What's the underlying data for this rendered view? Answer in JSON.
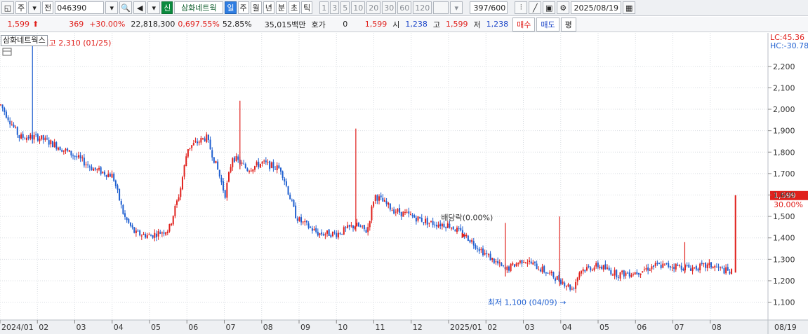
{
  "toolbar": {
    "market": "주",
    "prev_label": "전",
    "code": "046390",
    "badge_new": "신",
    "stock_name": "삼화네트웍",
    "periods": [
      "일",
      "주",
      "월",
      "년",
      "분",
      "초",
      "틱"
    ],
    "minutes": [
      "1",
      "3",
      "5",
      "10",
      "20",
      "30",
      "60",
      "120"
    ],
    "count": "397/600",
    "date": "2025/08/19"
  },
  "info": {
    "price": "1,599",
    "arrow": "⬆",
    "change": "369",
    "change_pct": "+30.00%",
    "volume": "22,818,300",
    "vol_pct": "0,697.55%",
    "turnover": "52.85%",
    "amount": "35,015백만",
    "quote_label": "호가",
    "quote_value": "0",
    "quote_price": "1,599",
    "open_label": "시",
    "open": "1,238",
    "high_label": "고",
    "high": "1,599",
    "low_label": "저",
    "low": "1,238",
    "buy": "매수",
    "sell": "매도",
    "flat": "평"
  },
  "chart_data": {
    "type": "candlestick",
    "title": "삼화네트웍스",
    "x_months": [
      "2024/01",
      "02",
      "03",
      "04",
      "05",
      "06",
      "07",
      "08",
      "09",
      "10",
      "11",
      "12",
      "2025/01",
      "02",
      "03",
      "04",
      "05",
      "06",
      "07",
      "08"
    ],
    "x_end_label": "08/19",
    "y_ticks": [
      1100,
      1200,
      1300,
      1400,
      1500,
      1600,
      1700,
      1800,
      1900,
      2000,
      2100,
      2200
    ],
    "y_tick_labels": [
      "1,100",
      "1,200",
      "1,300",
      "1,400",
      "1,500",
      "1,600",
      "1,700",
      "1,800",
      "1,900",
      "2,000",
      "2,100",
      "2,200"
    ],
    "ylim": [
      1030,
      2330
    ],
    "annotations": {
      "high": "최고 2,310 (01/25)",
      "low": "최저 1,100 (04/09)",
      "dividend": "배당락(0.00%)",
      "lc": "LC:45.36",
      "hc": "HC:-30.78"
    },
    "last_price_label": "1,599",
    "last_pct_label": "30.00%",
    "month_path": [
      [
        0,
        2020
      ],
      [
        0.5,
        1870
      ],
      [
        1,
        1870
      ],
      [
        1.5,
        1830
      ],
      [
        2,
        1780
      ],
      [
        2.5,
        1720
      ],
      [
        3,
        1690
      ],
      [
        3.3,
        1500
      ],
      [
        3.6,
        1420
      ],
      [
        4,
        1410
      ],
      [
        4.5,
        1440
      ],
      [
        4.8,
        1620
      ],
      [
        5,
        1820
      ],
      [
        5.5,
        1870
      ],
      [
        5.8,
        1720
      ],
      [
        6,
        1600
      ],
      [
        6.2,
        1780
      ],
      [
        6.6,
        1720
      ],
      [
        7,
        1750
      ],
      [
        7.5,
        1720
      ],
      [
        7.9,
        1500
      ],
      [
        8,
        1480
      ],
      [
        8.5,
        1420
      ],
      [
        9,
        1420
      ],
      [
        9.5,
        1460
      ],
      [
        9.8,
        1430
      ],
      [
        10,
        1600
      ],
      [
        10.5,
        1530
      ],
      [
        11,
        1500
      ],
      [
        11.5,
        1470
      ],
      [
        12,
        1460
      ],
      [
        12.5,
        1400
      ],
      [
        13,
        1320
      ],
      [
        13.5,
        1250
      ],
      [
        14,
        1300
      ],
      [
        14.5,
        1250
      ],
      [
        15,
        1200
      ],
      [
        15.3,
        1160
      ],
      [
        15.5,
        1250
      ],
      [
        16,
        1270
      ],
      [
        16.5,
        1230
      ],
      [
        17,
        1240
      ],
      [
        17.5,
        1270
      ],
      [
        18,
        1270
      ],
      [
        18.5,
        1260
      ],
      [
        19,
        1270
      ],
      [
        19.5,
        1240
      ]
    ],
    "spikes": [
      [
        0.85,
        2310
      ],
      [
        6.4,
        2040
      ],
      [
        9.5,
        1910
      ],
      [
        13.5,
        1470
      ],
      [
        14.95,
        1500
      ],
      [
        18.3,
        1380
      ]
    ]
  },
  "colors": {
    "up": "#e0201c",
    "down": "#1f5fd0",
    "grid": "#d9dde2"
  }
}
